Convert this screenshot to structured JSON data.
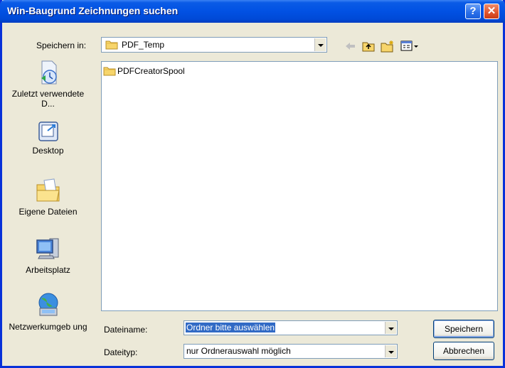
{
  "window": {
    "title": "Win-Baugrund Zeichnungen suchen"
  },
  "save_in": {
    "label": "Speichern in:",
    "value": "PDF_Temp"
  },
  "places": [
    {
      "label": "Zuletzt verwendete D...",
      "icon": "recent-documents-icon"
    },
    {
      "label": "Desktop",
      "icon": "desktop-icon"
    },
    {
      "label": "Eigene Dateien",
      "icon": "my-documents-icon"
    },
    {
      "label": "Arbeitsplatz",
      "icon": "my-computer-icon"
    },
    {
      "label": "Netzwerkumgeb ung",
      "icon": "network-icon"
    }
  ],
  "files": [
    {
      "name": "PDFCreatorSpool",
      "icon": "folder-icon"
    }
  ],
  "filename": {
    "label": "Dateiname:",
    "value": "Ordner bitte auswählen"
  },
  "filetype": {
    "label": "Dateityp:",
    "value": "nur Ordnerauswahl möglich"
  },
  "buttons": {
    "save": "Speichern",
    "cancel": "Abbrechen"
  },
  "colors": {
    "titlebar": "#0151e3",
    "selection": "#316ac5",
    "dialog_bg": "#ece9d8"
  }
}
